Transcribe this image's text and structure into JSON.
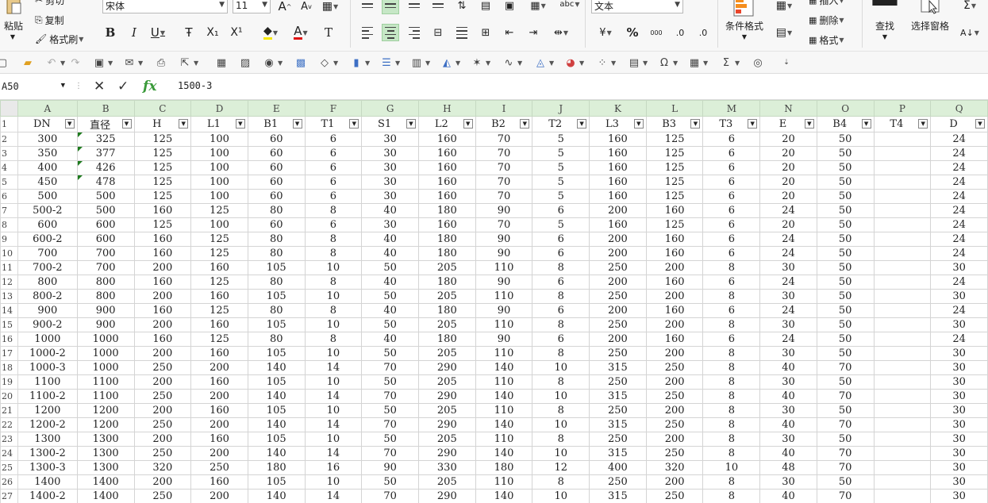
{
  "ribbon": {
    "cut": "剪切",
    "paste": "粘贴",
    "copy": "复制",
    "format_painter": "格式刷",
    "font_name": "宋体",
    "font_size": "11",
    "number_format": "文本",
    "conditional_format": "条件格式",
    "insert": "插入",
    "delete": "删除",
    "format": "格式",
    "find": "查找",
    "select_pane": "选择窗格",
    "increase_font": "A",
    "decrease_font": "A",
    "bold": "B",
    "italic": "I",
    "underline": "U",
    "strike": "Ŧ",
    "subscript": "X₁",
    "superscript": "X¹",
    "font_color": "A",
    "clear_format": "T",
    "percent": "%",
    "thousands": "000",
    "inc_decimal": ".0",
    "dec_decimal": ".0"
  },
  "formula_bar": {
    "cell_ref": "A50",
    "formula": "1500-3"
  },
  "columns": [
    "A",
    "B",
    "C",
    "D",
    "E",
    "F",
    "G",
    "H",
    "I",
    "J",
    "K",
    "L",
    "M",
    "N",
    "O",
    "P",
    "Q"
  ],
  "headers": [
    "DN",
    "直径",
    "H",
    "L1",
    "B1",
    "T1",
    "S1",
    "L2",
    "B2",
    "T2",
    "L3",
    "B3",
    "T3",
    "E",
    "B4",
    "T4",
    "D"
  ],
  "rows": [
    [
      "300",
      "325",
      "125",
      "100",
      "60",
      "6",
      "30",
      "160",
      "70",
      "5",
      "160",
      "125",
      "6",
      "20",
      "50",
      "",
      "24"
    ],
    [
      "350",
      "377",
      "125",
      "100",
      "60",
      "6",
      "30",
      "160",
      "70",
      "5",
      "160",
      "125",
      "6",
      "20",
      "50",
      "",
      "24"
    ],
    [
      "400",
      "426",
      "125",
      "100",
      "60",
      "6",
      "30",
      "160",
      "70",
      "5",
      "160",
      "125",
      "6",
      "20",
      "50",
      "",
      "24"
    ],
    [
      "450",
      "478",
      "125",
      "100",
      "60",
      "6",
      "30",
      "160",
      "70",
      "5",
      "160",
      "125",
      "6",
      "20",
      "50",
      "",
      "24"
    ],
    [
      "500",
      "500",
      "125",
      "100",
      "60",
      "6",
      "30",
      "160",
      "70",
      "5",
      "160",
      "125",
      "6",
      "20",
      "50",
      "",
      "24"
    ],
    [
      "500-2",
      "500",
      "160",
      "125",
      "80",
      "8",
      "40",
      "180",
      "90",
      "6",
      "200",
      "160",
      "6",
      "24",
      "50",
      "",
      "24"
    ],
    [
      "600",
      "600",
      "125",
      "100",
      "60",
      "6",
      "30",
      "160",
      "70",
      "5",
      "160",
      "125",
      "6",
      "20",
      "50",
      "",
      "24"
    ],
    [
      "600-2",
      "600",
      "160",
      "125",
      "80",
      "8",
      "40",
      "180",
      "90",
      "6",
      "200",
      "160",
      "6",
      "24",
      "50",
      "",
      "24"
    ],
    [
      "700",
      "700",
      "160",
      "125",
      "80",
      "8",
      "40",
      "180",
      "90",
      "6",
      "200",
      "160",
      "6",
      "24",
      "50",
      "",
      "24"
    ],
    [
      "700-2",
      "700",
      "200",
      "160",
      "105",
      "10",
      "50",
      "205",
      "110",
      "8",
      "250",
      "200",
      "8",
      "30",
      "50",
      "",
      "30"
    ],
    [
      "800",
      "800",
      "160",
      "125",
      "80",
      "8",
      "40",
      "180",
      "90",
      "6",
      "200",
      "160",
      "6",
      "24",
      "50",
      "",
      "24"
    ],
    [
      "800-2",
      "800",
      "200",
      "160",
      "105",
      "10",
      "50",
      "205",
      "110",
      "8",
      "250",
      "200",
      "8",
      "30",
      "50",
      "",
      "30"
    ],
    [
      "900",
      "900",
      "160",
      "125",
      "80",
      "8",
      "40",
      "180",
      "90",
      "6",
      "200",
      "160",
      "6",
      "24",
      "50",
      "",
      "24"
    ],
    [
      "900-2",
      "900",
      "200",
      "160",
      "105",
      "10",
      "50",
      "205",
      "110",
      "8",
      "250",
      "200",
      "8",
      "30",
      "50",
      "",
      "30"
    ],
    [
      "1000",
      "1000",
      "160",
      "125",
      "80",
      "8",
      "40",
      "180",
      "90",
      "6",
      "200",
      "160",
      "6",
      "24",
      "50",
      "",
      "24"
    ],
    [
      "1000-2",
      "1000",
      "200",
      "160",
      "105",
      "10",
      "50",
      "205",
      "110",
      "8",
      "250",
      "200",
      "8",
      "30",
      "50",
      "",
      "30"
    ],
    [
      "1000-3",
      "1000",
      "250",
      "200",
      "140",
      "14",
      "70",
      "290",
      "140",
      "10",
      "315",
      "250",
      "8",
      "40",
      "70",
      "",
      "30"
    ],
    [
      "1100",
      "1100",
      "200",
      "160",
      "105",
      "10",
      "50",
      "205",
      "110",
      "8",
      "250",
      "200",
      "8",
      "30",
      "50",
      "",
      "30"
    ],
    [
      "1100-2",
      "1100",
      "250",
      "200",
      "140",
      "14",
      "70",
      "290",
      "140",
      "10",
      "315",
      "250",
      "8",
      "40",
      "70",
      "",
      "30"
    ],
    [
      "1200",
      "1200",
      "200",
      "160",
      "105",
      "10",
      "50",
      "205",
      "110",
      "8",
      "250",
      "200",
      "8",
      "30",
      "50",
      "",
      "30"
    ],
    [
      "1200-2",
      "1200",
      "250",
      "200",
      "140",
      "14",
      "70",
      "290",
      "140",
      "10",
      "315",
      "250",
      "8",
      "40",
      "70",
      "",
      "30"
    ],
    [
      "1300",
      "1300",
      "200",
      "160",
      "105",
      "10",
      "50",
      "205",
      "110",
      "8",
      "250",
      "200",
      "8",
      "30",
      "50",
      "",
      "30"
    ],
    [
      "1300-2",
      "1300",
      "250",
      "200",
      "140",
      "14",
      "70",
      "290",
      "140",
      "10",
      "315",
      "250",
      "8",
      "40",
      "70",
      "",
      "30"
    ],
    [
      "1300-3",
      "1300",
      "320",
      "250",
      "180",
      "16",
      "90",
      "330",
      "180",
      "12",
      "400",
      "320",
      "10",
      "48",
      "70",
      "",
      "30"
    ],
    [
      "1400",
      "1400",
      "200",
      "160",
      "105",
      "10",
      "50",
      "205",
      "110",
      "8",
      "250",
      "200",
      "8",
      "30",
      "50",
      "",
      "30"
    ],
    [
      "1400-2",
      "1400",
      "250",
      "200",
      "140",
      "14",
      "70",
      "290",
      "140",
      "10",
      "315",
      "250",
      "8",
      "40",
      "70",
      "",
      "30"
    ]
  ],
  "text_marked_rows": [
    0,
    1,
    2,
    3
  ],
  "colors": {
    "column_header_bg": "#dcefd8",
    "selected_format_bg": "#c6e7c6",
    "error_triangle": "#1e7b1e",
    "fx_green": "#3a9a3a"
  }
}
